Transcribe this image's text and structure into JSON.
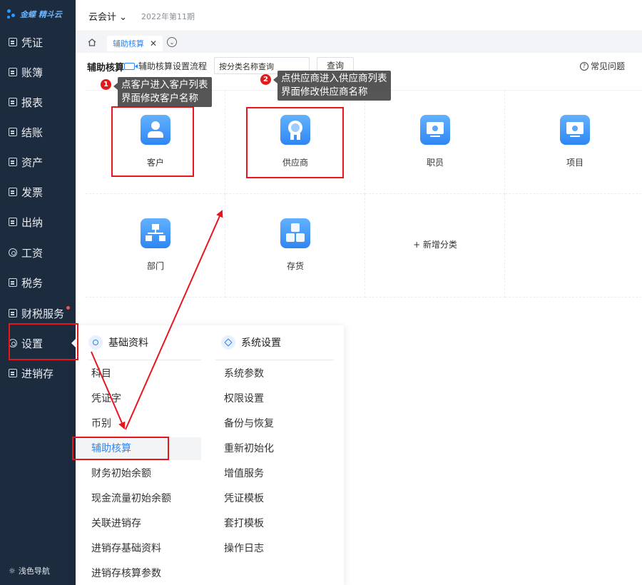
{
  "sidebar": {
    "logo_text": "金蝶 精斗云",
    "items": [
      {
        "label": "凭证",
        "icon": "doc-icon"
      },
      {
        "label": "账簿",
        "icon": "book-icon"
      },
      {
        "label": "报表",
        "icon": "report-icon"
      },
      {
        "label": "结账",
        "icon": "close-book-icon"
      },
      {
        "label": "资产",
        "icon": "asset-icon"
      },
      {
        "label": "发票",
        "icon": "invoice-icon"
      },
      {
        "label": "出纳",
        "icon": "cashier-icon"
      },
      {
        "label": "工资",
        "icon": "yen-icon"
      },
      {
        "label": "税务",
        "icon": "tax-icon"
      },
      {
        "label": "财税服务",
        "icon": "service-icon",
        "badge": true
      },
      {
        "label": "设置",
        "icon": "gear-icon",
        "active": true
      },
      {
        "label": "进销存",
        "icon": "inventory-icon"
      }
    ],
    "footer_label": "浅色导航"
  },
  "header": {
    "org_name": "云会计",
    "period": "2022年第11期"
  },
  "tabs": {
    "active_label": "辅助核算",
    "close_glyph": "✕"
  },
  "toolbar": {
    "title": "辅助核算",
    "flow_link": "辅助核算设置流程",
    "search_value": "按分类名称查询",
    "query_button": "查询",
    "faq_label": "常见问题"
  },
  "categories": [
    {
      "label": "客户",
      "icon": "user-icon"
    },
    {
      "label": "供应商",
      "icon": "medal-icon"
    },
    {
      "label": "职员",
      "icon": "monitor-icon"
    },
    {
      "label": "项目",
      "icon": "monitor-icon"
    },
    {
      "label": "部门",
      "icon": "org-chart-icon"
    },
    {
      "label": "存货",
      "icon": "cubes-icon"
    },
    {
      "label": "+ 新增分类",
      "icon": ""
    }
  ],
  "menu": {
    "basic_title": "基础资料",
    "system_title": "系统设置",
    "basic_items": [
      "科目",
      "凭证字",
      "币别",
      "辅助核算",
      "财务初始余额",
      "现金流量初始余额",
      "关联进销存",
      "进销存基础资料",
      "进销存核算参数"
    ],
    "system_items": [
      "系统参数",
      "权限设置",
      "备份与恢复",
      "重新初始化",
      "增值服务",
      "凭证模板",
      "套打模板",
      "操作日志"
    ],
    "selected": "辅助核算"
  },
  "annotations": {
    "callout1_num": "1",
    "callout1_line1": "点客户进入客户列表",
    "callout1_line2": "界面修改客户名称",
    "callout2_num": "2",
    "callout2_line1": "点供应商进入供应商列表",
    "callout2_line2": "界面修改供应商名称",
    "highlight_color": "#e8161c",
    "accent_color": "#2e86f6"
  }
}
